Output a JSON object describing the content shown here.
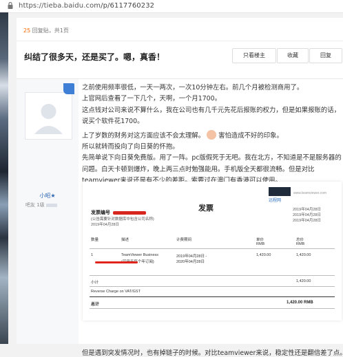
{
  "browser": {
    "url_host": "https://tieba.baidu.com",
    "url_path": "/p/6117760232"
  },
  "thread": {
    "reply_count": "25",
    "reply_label": "回复贴，共1页",
    "title": "纠结了很多天，还是买了。嗯，真香！",
    "buttons": {
      "only_op": "只看楼主",
      "favorite": "收藏",
      "reply": "回复"
    }
  },
  "author": {
    "name": "小昭★",
    "badge": "吧友 1级"
  },
  "post": {
    "lines": [
      "之前使用频率很低，一天一两次，一次10分钟左右。前几个月被检测商用了。",
      "上官网后查看了一下几个，天啊，一个月1700。",
      "这点钱对公司来说不算什么，我在公司也有几千元先花后报账的权力，但是如果报账的话，",
      "说买个软件花1700。",
      "上了岁数的财务对这方面应该不会太理解。",
      "害怕造成不好的印象。",
      "所以就转而投向了向日葵的怀抱。",
      "先简单说下向日葵免费版。用了一阵。pc版假死于无吧。我在北方，不知道是不是服务器的",
      "问题。白天卡顿到爆炸，晚上两三点时勉强能用。手机版全天都很流畅。但是对比",
      "teamviewer来说还是有不少的差距。索要过在澳门有香港可以使用。"
    ],
    "bottom_line": "但是遇到突发情况时，也有掉链子的时候。对比teamviewer来说，稳定性还是翻倍差了点。"
  },
  "invoice": {
    "title": "发票",
    "number_label": "发票编号",
    "sub1": "(公告需要针对数据库中包含公司名称)",
    "sub2": "2019年04月28日",
    "logo": "远程网",
    "site": "www.teamviewer.com",
    "right_dates": [
      "2019年04月28日",
      "2019年04月28日",
      "2019年04月28日"
    ],
    "headers": [
      "数量",
      "描述",
      "计费期间",
      "单价",
      "总价"
    ],
    "currency": "RMB",
    "row": {
      "qty": "1",
      "desc": "TeamViewer Business",
      "desc2": "(可用于每个年订阅)",
      "period1": "2019年04月28日 -",
      "period2": "2020年04月28日",
      "price": "1,420.00",
      "total": "1,420.00"
    },
    "subtotal_label": "小计",
    "subtotal": "1,420.00",
    "reverse_charge": "Reverse Charge on VAT/GST",
    "total_label": "总计",
    "total": "1,420.00 RMB"
  },
  "colors": {
    "accent": "#3f7fd6",
    "count": "#ff6600",
    "redact": "#d7261e"
  }
}
